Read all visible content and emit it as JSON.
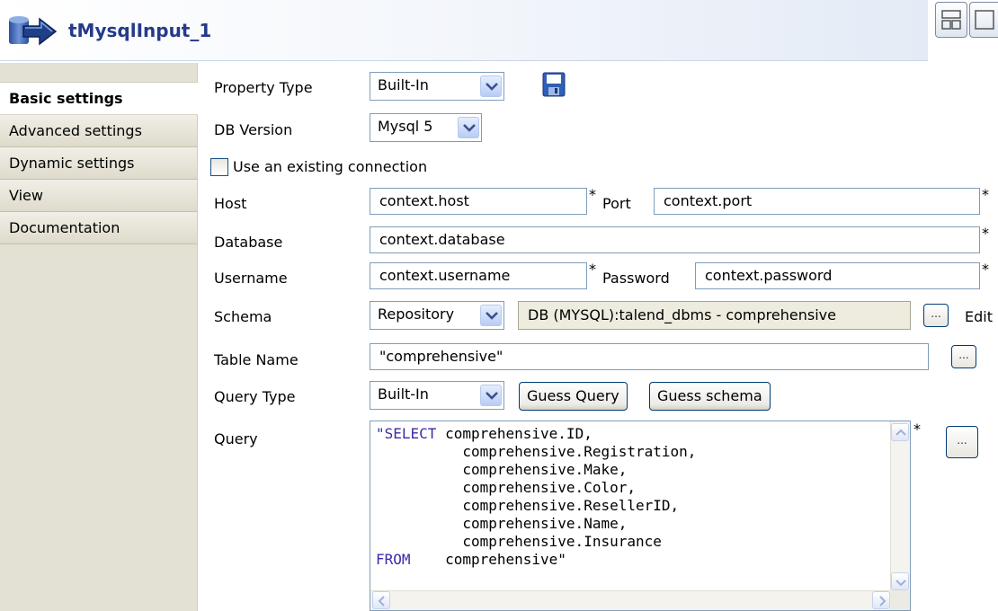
{
  "component": {
    "title": "tMysqlInput_1",
    "icon": "input-arrow-icon"
  },
  "sidebar": {
    "tabs": [
      {
        "label": "Basic settings",
        "active": true
      },
      {
        "label": "Advanced settings"
      },
      {
        "label": "Dynamic settings"
      },
      {
        "label": "View"
      },
      {
        "label": "Documentation"
      }
    ]
  },
  "form": {
    "property_type": {
      "label": "Property Type",
      "value": "Built-In"
    },
    "db_version": {
      "label": "DB Version",
      "value": "Mysql 5"
    },
    "use_existing": {
      "label": "Use an existing connection",
      "checked": false
    },
    "host": {
      "label": "Host",
      "value": "context.host"
    },
    "port": {
      "label": "Port",
      "value": "context.port"
    },
    "database": {
      "label": "Database",
      "value": "context.database"
    },
    "username": {
      "label": "Username",
      "value": "context.username"
    },
    "password": {
      "label": "Password",
      "value": "context.password"
    },
    "schema": {
      "label": "Schema",
      "type_value": "Repository",
      "value": "DB (MYSQL):talend_dbms - comprehensive",
      "edit_label": "Edit"
    },
    "table_name": {
      "label": "Table Name",
      "value": "\"comprehensive\""
    },
    "query_type": {
      "label": "Query Type",
      "value": "Built-In",
      "guess_query": "Guess Query",
      "guess_schema": "Guess schema"
    },
    "query": {
      "label": "Query",
      "keyword_select": "\"SELECT",
      "keyword_from": "FROM",
      "lines": [
        " comprehensive.ID,",
        "          comprehensive.Registration,",
        "          comprehensive.Make,",
        "          comprehensive.Color,",
        "          comprehensive.ResellerID,",
        "          comprehensive.Name,",
        "          comprehensive.Insurance"
      ],
      "from_line": "    comprehensive\""
    },
    "required_mark": "*",
    "dots_label": "..."
  },
  "colors": {
    "title": "#253a8a",
    "keyword": "#3b2ba8",
    "sidebar_bg": "#e3e1d4",
    "input_border": "#7f9db9"
  }
}
